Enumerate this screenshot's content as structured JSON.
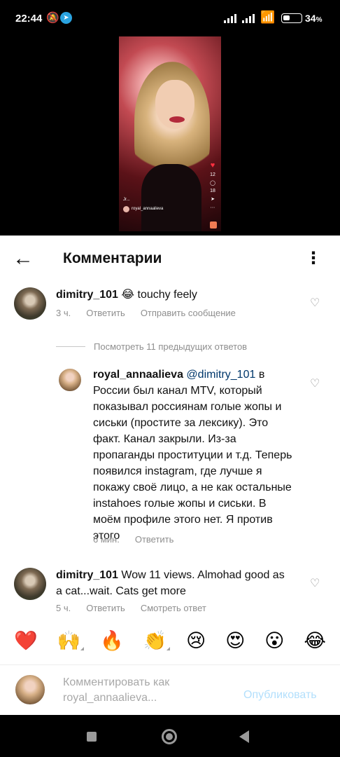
{
  "status_bar": {
    "time": "22:44",
    "battery": "34",
    "battery_unit": "%",
    "icons": [
      "bell-off-icon",
      "telegram-icon",
      "signal-icon",
      "signal-icon",
      "wifi-icon",
      "battery-icon"
    ]
  },
  "video": {
    "side_counts": [
      "12",
      "18"
    ],
    "audio_line": "Jr..."
  },
  "header": {
    "title": "Комментарии",
    "back_icon": "arrow-left-icon",
    "menu_icon": "more-vertical-icon"
  },
  "comments": [
    {
      "username": "dimitry_101",
      "text": "😂 touchy feely",
      "time": "3 ч.",
      "reply_label": "Ответить",
      "extra_label": "Отправить сообщение"
    },
    {
      "username": "royal_annaalieva",
      "mention": "@dimitry_101",
      "text": "в России был канал MTV, который показывал россиянам голые жопы и сиськи (простите за лексику). Это факт. Канал закрыли. Из-за пропаганды проституции и т.д. Теперь появился instagram, где лучше я покажу своё лицо, а не как остальные instahoes голые жопы и сиськи. В моём профиле этого нет. Я против этого",
      "time": "6 мин.",
      "reply_label": "Ответить"
    },
    {
      "username": "dimitry_101",
      "text": "Wow 11 views. Almohad good as a cat...wait. Cats get more",
      "time": "5 ч.",
      "reply_label": "Ответить",
      "extra_label": "Смотреть ответ"
    }
  ],
  "view_previous": "Посмотреть 11 предыдущих ответов",
  "emoji_bar": [
    "❤️",
    "🙌",
    "🔥",
    "👏",
    "😢",
    "😍",
    "😮",
    "😂"
  ],
  "compose": {
    "placeholder": "Комментировать как royal_annaalieva...",
    "post_label": "Опубликовать"
  }
}
